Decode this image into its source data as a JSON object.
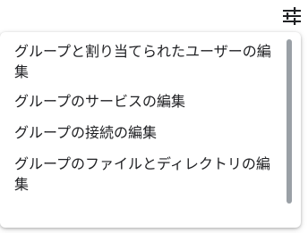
{
  "toolbar": {
    "filter_icon": "tune-sliders-icon"
  },
  "menu": {
    "items": [
      {
        "label": "グループと割り当てられたユーザーの編集"
      },
      {
        "label": "グループのサービスの編集"
      },
      {
        "label": "グループの接続の編集"
      },
      {
        "label": "グループのファイルとディレクトリの編集"
      }
    ]
  },
  "colors": {
    "text": "#202124",
    "scrollbar": "#9aa0a6"
  }
}
